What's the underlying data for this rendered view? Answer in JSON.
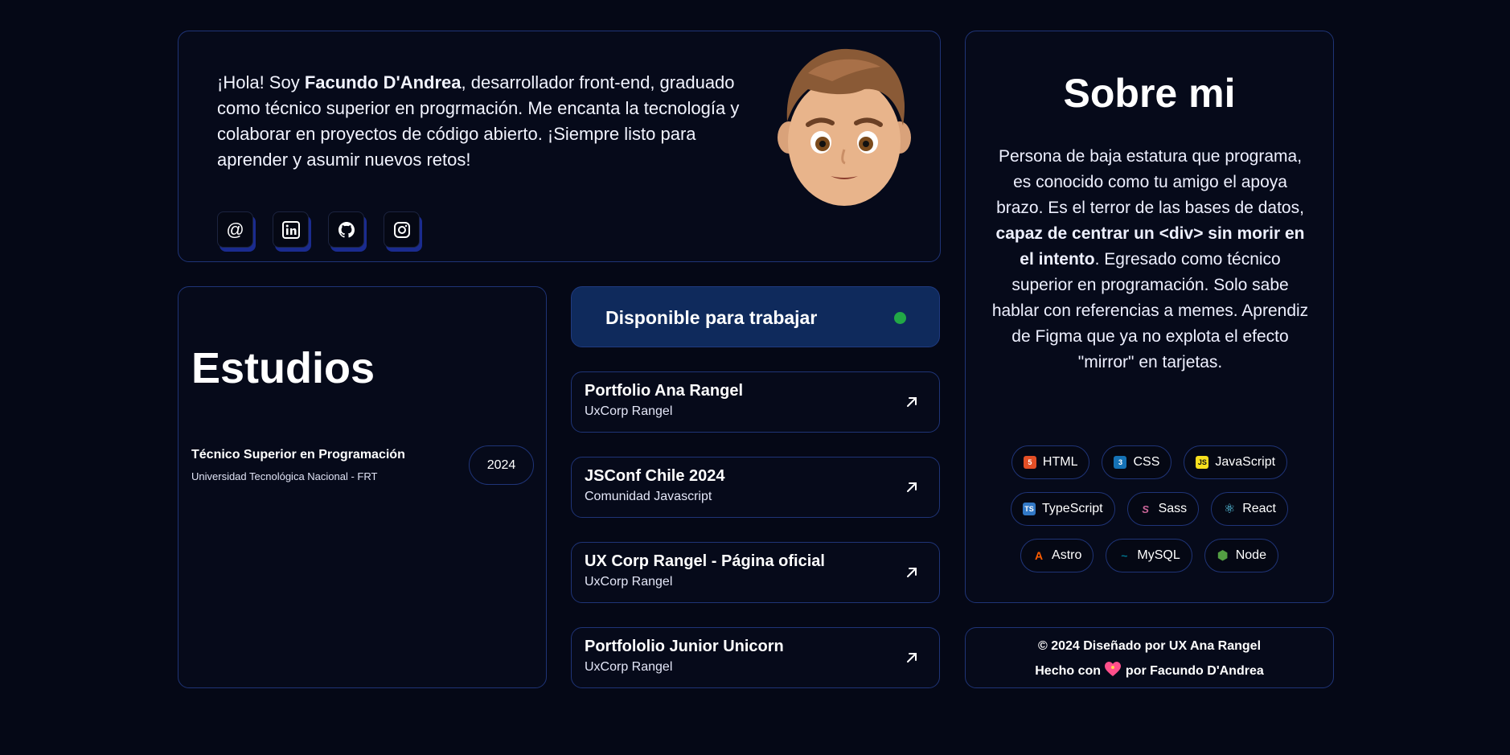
{
  "intro": {
    "greeting": "¡Hola! Soy ",
    "name": "Facundo D'Andrea",
    "text": ", desarrollador front-end, graduado como técnico superior en progrmación. Me encanta la tecnología y colaborar en proyectos de código abierto. ¡Siempre listo para aprender y asumir nuevos retos!",
    "socials": [
      {
        "icon": "at-icon",
        "glyph": "@"
      },
      {
        "icon": "linkedin-icon"
      },
      {
        "icon": "github-icon"
      },
      {
        "icon": "instagram-icon"
      }
    ]
  },
  "about": {
    "title": "Sobre mi",
    "body_1": "Persona de baja estatura que programa, es conocido como tu amigo el apoya brazo. Es el terror de las bases de datos, ",
    "body_bold": "capaz de centrar un <div> sin morir en el intento",
    "body_2": ". Egresado como técnico superior en programación. Solo sabe hablar con referencias a memes. Aprendiz de Figma que ya no explota el efecto \"mirror\" en tarjetas.",
    "tech": [
      {
        "label": "HTML",
        "color": "#e34f26",
        "glyph": "5"
      },
      {
        "label": "CSS",
        "color": "#1572b6",
        "glyph": "3"
      },
      {
        "label": "JavaScript",
        "color": "#f7df1e",
        "glyph": "JS"
      },
      {
        "label": "TypeScript",
        "color": "#3178c6",
        "glyph": "TS"
      },
      {
        "label": "Sass",
        "color": "#cc6699",
        "glyph": "S"
      },
      {
        "label": "React",
        "color": "#61dafb",
        "glyph": "⚛"
      },
      {
        "label": "Astro",
        "color": "#ff5d01",
        "glyph": "A"
      },
      {
        "label": "MySQL",
        "color": "#00758f",
        "glyph": "~"
      },
      {
        "label": "Node",
        "color": "#539e43",
        "glyph": "⬢"
      }
    ]
  },
  "studies": {
    "title": "Estudios",
    "degree": "Técnico Superior en Programación",
    "institution": "Universidad Tecnológica Nacional - FRT",
    "year": "2024"
  },
  "availability": {
    "label": "Disponible para trabajar",
    "status_color": "#22a846"
  },
  "projects": [
    {
      "title": "Portfolio Ana Rangel",
      "subtitle": "UxCorp Rangel"
    },
    {
      "title": "JSConf Chile 2024",
      "subtitle": "Comunidad Javascript"
    },
    {
      "title": "UX Corp Rangel - Página oficial",
      "subtitle": "UxCorp Rangel"
    },
    {
      "title": "Portfololio Junior Unicorn",
      "subtitle": "UxCorp Rangel"
    }
  ],
  "footer": {
    "line1": "© 2024 Diseñado por UX Ana Rangel",
    "line2_a": "Hecho con ",
    "line2_b": " por Facundo D'Andrea"
  }
}
